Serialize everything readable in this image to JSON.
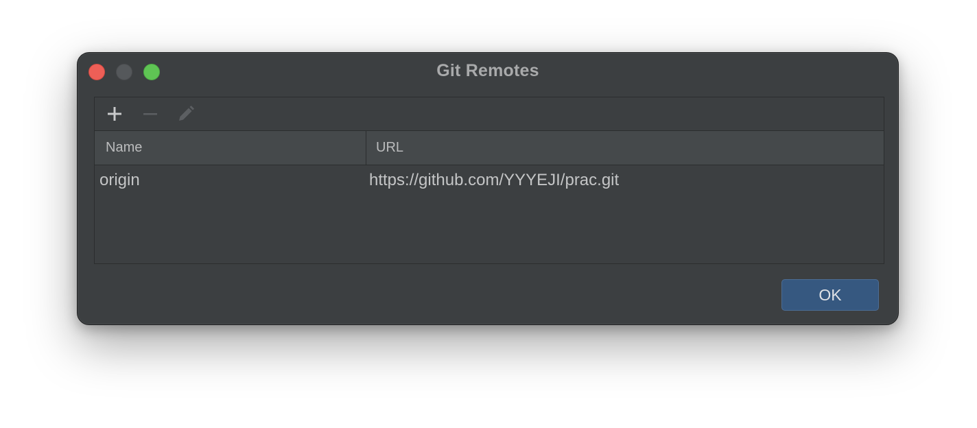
{
  "window": {
    "title": "Git Remotes"
  },
  "toolbar": {
    "add_icon": "plus-icon",
    "remove_icon": "minus-icon",
    "edit_icon": "pencil-icon"
  },
  "table": {
    "columns": [
      "Name",
      "URL"
    ],
    "rows": [
      {
        "name": "origin",
        "url": "https://github.com/YYYEJI/prac.git"
      }
    ]
  },
  "footer": {
    "ok_label": "OK"
  },
  "colors": {
    "background": "#3c3f41",
    "accent": "#365880",
    "close": "#ee5f57",
    "maximize": "#5fc454"
  }
}
